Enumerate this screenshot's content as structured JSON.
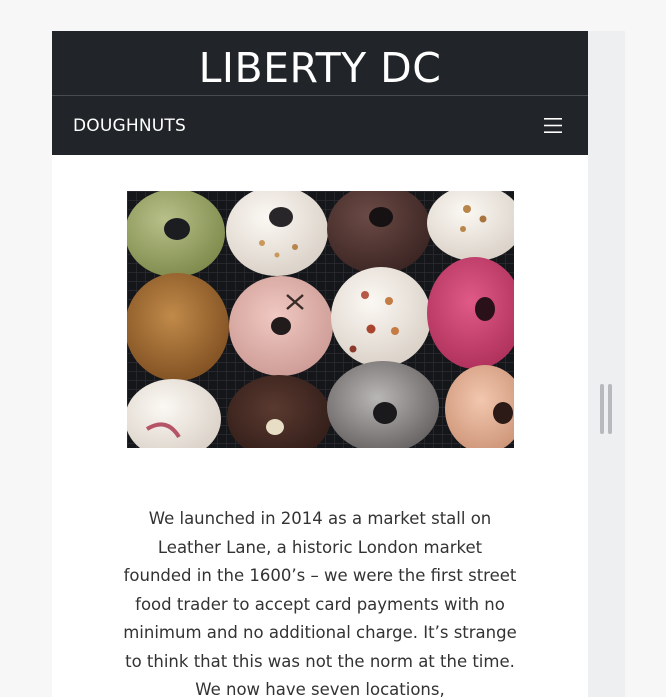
{
  "header": {
    "title": "LIBERTY DC"
  },
  "navbar": {
    "brand": "DOUGHNUTS",
    "toggler_icon": "hamburger-menu-icon"
  },
  "main": {
    "photo_subject": "doughnuts",
    "intro_text": "We launched in 2014 as a market stall on Leather Lane, a historic London market founded in the 1600’s – we were the first street food trader to accept card payments with no minimum and no additional charge. It’s strange to think that this was not the norm at the time. We now have seven locations,"
  },
  "colors": {
    "header_bg": "#212529",
    "page_bg": "#f7f7f7",
    "text": "#333333"
  }
}
